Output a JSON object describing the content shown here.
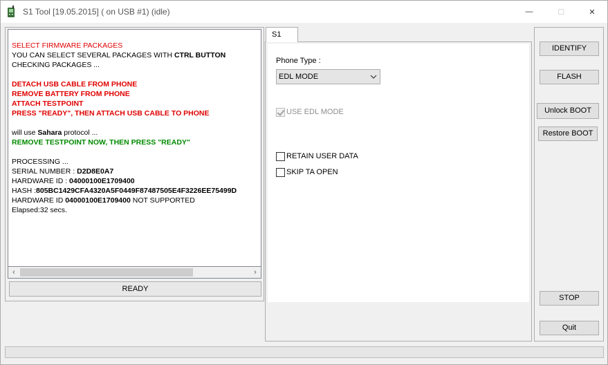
{
  "window": {
    "title": "S1 Tool [19.05.2015] ( on USB #1) (idle)",
    "minimize_glyph": "—",
    "maximize_glyph": "☐",
    "close_glyph": "✕"
  },
  "log": {
    "l1": "SELECT FIRMWARE PACKAGES",
    "l2_pre": "YOU CAN SELECT SEVERAL PACKAGES WITH ",
    "l2_bold": "CTRL BUTTON",
    "l3": "CHECKING PACKAGES ...",
    "l4": "DETACH USB CABLE FROM PHONE",
    "l5": "REMOVE BATTERY FROM PHONE",
    "l6": "ATTACH TESTPOINT",
    "l7": "PRESS \"READY\", THEN ATTACH USB CABLE TO PHONE",
    "l8_pre": "will use ",
    "l8_bold": "Sahara",
    "l8_post": " protocol ...",
    "l9": "REMOVE TESTPOINT NOW, THEN PRESS \"READY\"",
    "l10": "PROCESSING ...",
    "l11_pre": "SERIAL NUMBER : ",
    "l11_val": "D2D8E0A7",
    "l12_pre": "HARDWARE ID : ",
    "l12_val": "04000100E1709400",
    "l13_pre": "HASH :",
    "l13_val": "805BC1429CFA4320A5F0449F87487505E4F3226EE75499D",
    "l14_pre": "HARDWARE ID ",
    "l14_val": "04000100E1709400",
    "l14_post": " NOT SUPPORTED",
    "l15": "Elapsed:32 secs."
  },
  "status": {
    "ready_label": "READY"
  },
  "tabs": {
    "s1_label": "S1"
  },
  "options": {
    "phone_type_label": "Phone Type :",
    "phone_type_value": "EDL MODE",
    "use_edl_mode": "USE EDL MODE",
    "retain_user_data": "RETAIN USER DATA",
    "skip_ta_open": "SKIP TA OPEN"
  },
  "buttons": {
    "identify": "IDENTIFY",
    "flash": "FLASH",
    "unlock_boot": "Unlock BOOT",
    "restore_boot": "Restore BOOT",
    "stop": "STOP",
    "quit": "Quit"
  },
  "scroll": {
    "left_glyph": "‹",
    "right_glyph": "›"
  }
}
